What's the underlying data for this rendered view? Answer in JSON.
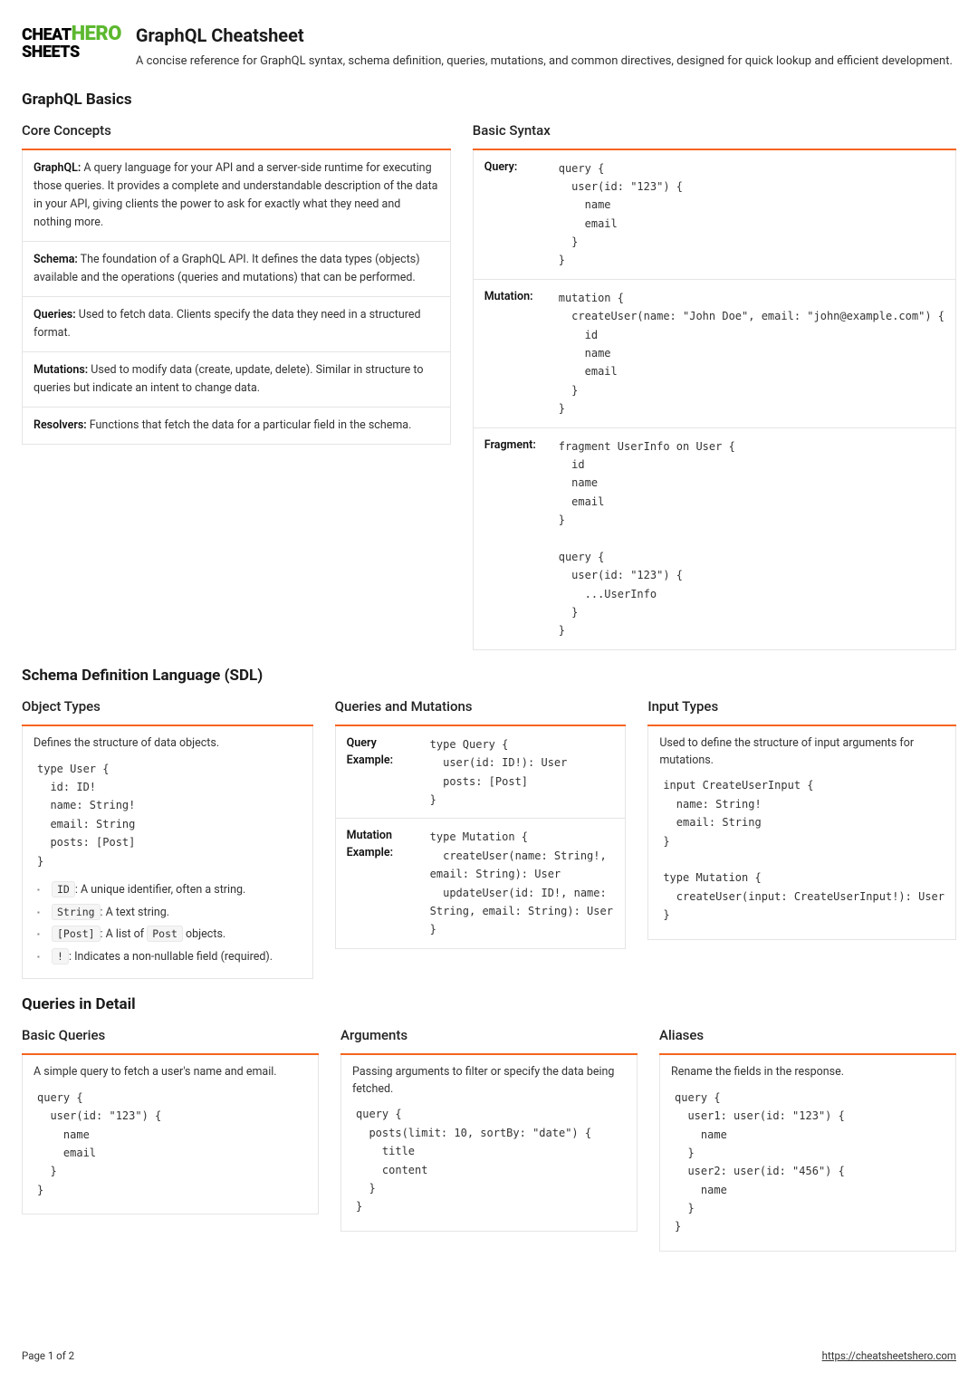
{
  "logo": {
    "line1_black": "CHEAT",
    "line1_green": "HERO",
    "line2_black": "SHEETS"
  },
  "header": {
    "title": "GraphQL Cheatsheet",
    "subtitle": "A concise reference for GraphQL syntax, schema definition, queries, mutations, and common directives, designed for quick lookup and efficient development."
  },
  "sections": {
    "basics": {
      "title": "GraphQL Basics",
      "core": {
        "title": "Core Concepts",
        "items": [
          {
            "term": "GraphQL:",
            "text": " A query language for your API and a server-side runtime for executing those queries. It provides a complete and understandable description of the data in your API, giving clients the power to ask for exactly what they need and nothing more."
          },
          {
            "term": "Schema:",
            "text": " The foundation of a GraphQL API. It defines the data types (objects) available and the operations (queries and mutations) that can be performed."
          },
          {
            "term": "Queries:",
            "text": " Used to fetch data. Clients specify the data they need in a structured format."
          },
          {
            "term": "Mutations:",
            "text": " Used to modify data (create, update, delete). Similar in structure to queries but indicate an intent to change data."
          },
          {
            "term": "Resolvers:",
            "text": " Functions that fetch the data for a particular field in the schema."
          }
        ]
      },
      "syntax": {
        "title": "Basic Syntax",
        "items": [
          {
            "label": "Query:",
            "code": "query {\n  user(id: \"123\") {\n    name\n    email\n  }\n}"
          },
          {
            "label": "Mutation:",
            "code": "mutation {\n  createUser(name: \"John Doe\", email: \"john@example.com\") {\n    id\n    name\n    email\n  }\n}"
          },
          {
            "label": "Fragment:",
            "code": "fragment UserInfo on User {\n  id\n  name\n  email\n}\n\nquery {\n  user(id: \"123\") {\n    ...UserInfo\n  }\n}"
          }
        ]
      }
    },
    "sdl": {
      "title": "Schema Definition Language (SDL)",
      "object_types": {
        "title": "Object Types",
        "desc": "Defines the structure of data objects.",
        "code": "type User {\n  id: ID!\n  name: String!\n  email: String\n  posts: [Post]\n}",
        "bullets": [
          {
            "code": "ID",
            "text": ": A unique identifier, often a string."
          },
          {
            "code": "String",
            "text": ": A text string."
          },
          {
            "code": "[Post]",
            "text": ": A list of ",
            "code2": "Post",
            "text2": " objects."
          },
          {
            "code": "!",
            "text": ": Indicates a non-nullable field (required)."
          }
        ]
      },
      "queries_mutations": {
        "title": "Queries and Mutations",
        "items": [
          {
            "label": "Query Example:",
            "code": "type Query {\n  user(id: ID!): User\n  posts: [Post]\n}"
          },
          {
            "label": "Mutation Example:",
            "code": "type Mutation {\n  createUser(name: String!,\nemail: String): User\n  updateUser(id: ID!, name:\nString, email: String): User\n}"
          }
        ]
      },
      "input_types": {
        "title": "Input Types",
        "desc": "Used to define the structure of input arguments for mutations.",
        "code": "input CreateUserInput {\n  name: String!\n  email: String\n}\n\ntype Mutation {\n  createUser(input: CreateUserInput!): User\n}"
      }
    },
    "queries": {
      "title": "Queries in Detail",
      "basic": {
        "title": "Basic Queries",
        "desc": "A simple query to fetch a user's name and email.",
        "code": "query {\n  user(id: \"123\") {\n    name\n    email\n  }\n}"
      },
      "arguments": {
        "title": "Arguments",
        "desc": "Passing arguments to filter or specify the data being fetched.",
        "code": "query {\n  posts(limit: 10, sortBy: \"date\") {\n    title\n    content\n  }\n}"
      },
      "aliases": {
        "title": "Aliases",
        "desc": "Rename the fields in the response.",
        "code": "query {\n  user1: user(id: \"123\") {\n    name\n  }\n  user2: user(id: \"456\") {\n    name\n  }\n}"
      }
    }
  },
  "footer": {
    "page": "Page 1 of 2",
    "url": "https://cheatsheetshero.com"
  }
}
